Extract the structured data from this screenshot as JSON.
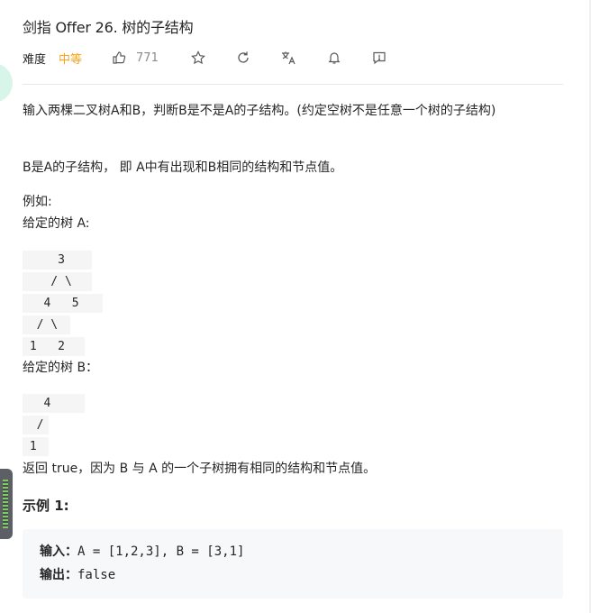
{
  "problem": {
    "title": "剑指 Offer 26. 树的子结构",
    "difficulty_label": "难度",
    "difficulty": "中等",
    "likes": "771"
  },
  "icons": {
    "like": "thumbs-up-icon",
    "star": "star-icon",
    "refresh": "refresh-icon",
    "translate": "translate-icon",
    "bell": "bell-icon",
    "feedback": "feedback-icon"
  },
  "colors": {
    "difficulty_medium": "#ffa116",
    "code_background": "#f5f5f5",
    "example_background": "#f7f8fa"
  },
  "description": {
    "p1": "输入两棵二叉树A和B，判断B是不是A的子结构。(约定空树不是任意一个树的子结构)",
    "p2": "B是A的子结构， 即 A中有出现和B相同的结构和节点值。",
    "example_intro": "例如:",
    "tree_a_label": "给定的树 A:",
    "tree_a_lines": [
      "     3",
      "    / \\",
      "   4   5",
      "  / \\",
      " 1   2"
    ],
    "tree_b_label": "给定的树 B：",
    "tree_b_lines": [
      "   4 ",
      "  /",
      " 1"
    ],
    "conclusion": "返回 true，因为 B 与 A 的一个子树拥有相同的结构和节点值。"
  },
  "example1": {
    "title": "示例 1:",
    "input_label": "输入：",
    "input_value": "A = [1,2,3], B = [3,1]",
    "output_label": "输出：",
    "output_value": "false"
  }
}
